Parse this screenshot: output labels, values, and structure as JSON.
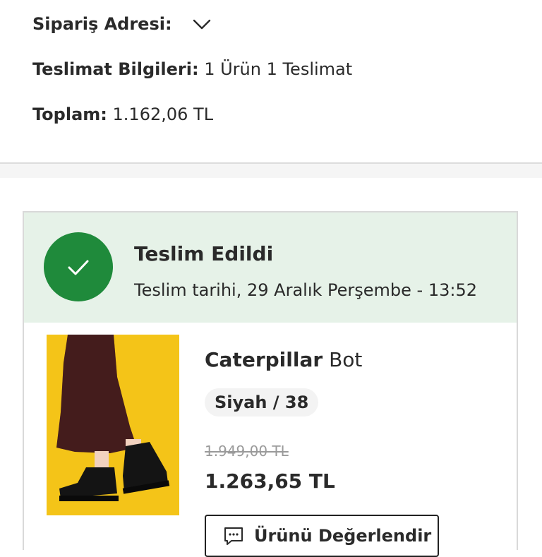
{
  "order_summary": {
    "address_label": "Sipariş Adresi:",
    "delivery_label": "Teslimat Bilgileri:",
    "delivery_value": "1 Ürün 1 Teslimat",
    "total_label": "Toplam:",
    "total_value": "1.162,06 TL"
  },
  "shipment": {
    "status_title": "Teslim Edildi",
    "delivery_date": "Teslim tarihi, 29 Aralık Perşembe - 13:52",
    "status_color": "#1f8a3b",
    "status_bg": "#e6f2e8"
  },
  "product": {
    "brand": "Caterpillar",
    "name": "Bot",
    "variant": "Siyah / 38",
    "old_price": "1.949,00 TL",
    "price": "1.263,65 TL",
    "review_button_label": "Ürünü Değerlendir",
    "image_bg": "#f4c418"
  },
  "icons": {
    "address_toggle": "chevron-down-icon",
    "status": "check-icon",
    "review": "chat-bubble-icon"
  }
}
